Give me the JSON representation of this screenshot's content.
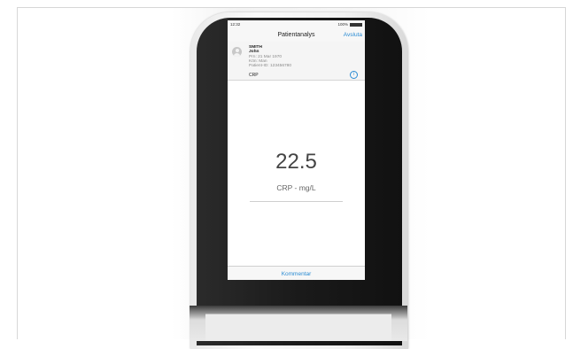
{
  "status_bar": {
    "time": "12:32",
    "battery_text": "100%"
  },
  "header": {
    "title": "Patientanalys",
    "action_label": "Avsluta"
  },
  "patient": {
    "last_name": "SMITH",
    "first_name": "John",
    "birth": "Prn: 21 Mar 1970",
    "sex": "Kön: Man",
    "patient_id": "Patient-ID: 123456780"
  },
  "test": {
    "label": "CRP",
    "info_glyph": "i"
  },
  "result": {
    "value": "22.5",
    "unit": "CRP - mg/L"
  },
  "footer": {
    "comment_label": "Kommentar"
  },
  "colors": {
    "accent": "#2a8bd3",
    "device_black": "#1a1a1a"
  }
}
